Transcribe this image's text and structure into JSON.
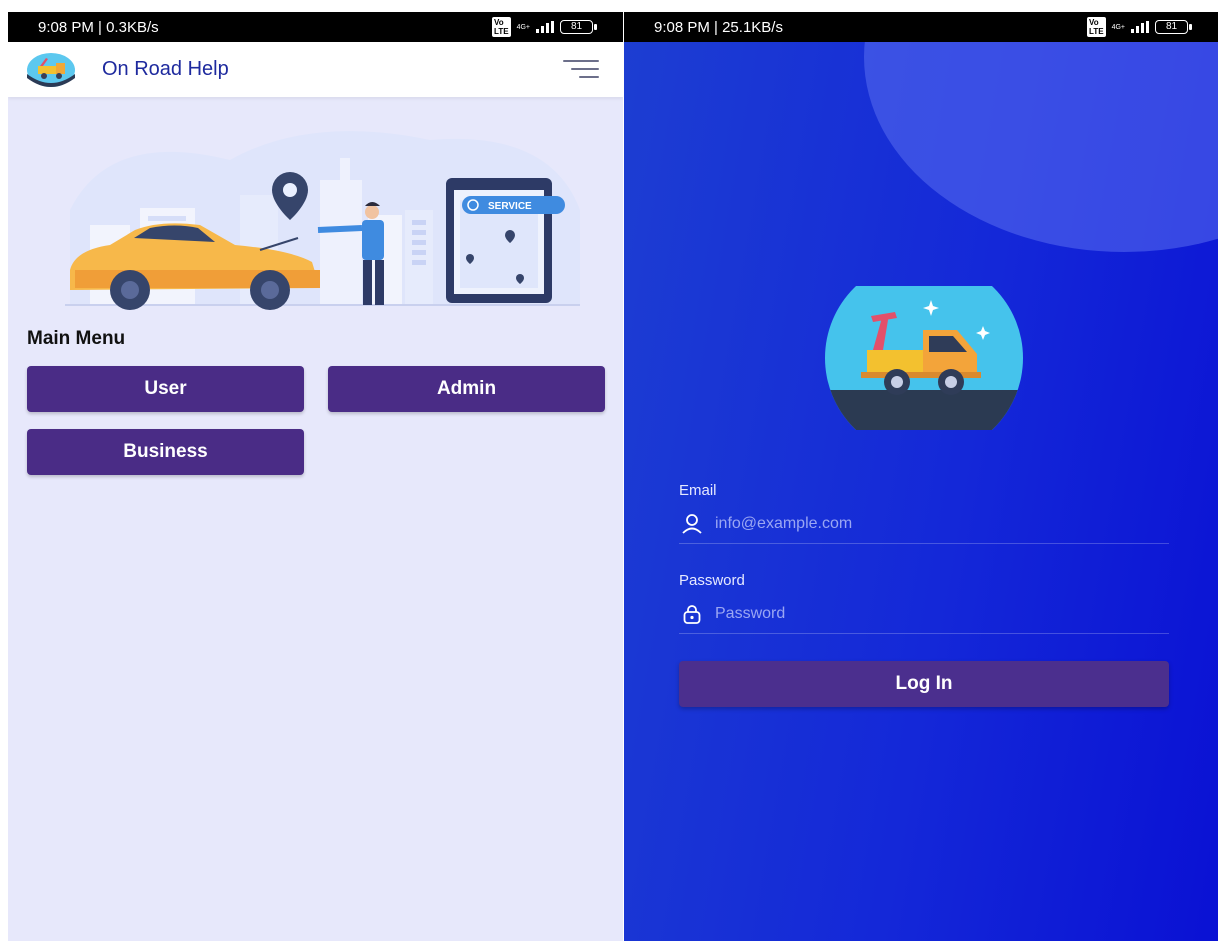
{
  "left_screen": {
    "status_bar": {
      "time_speed": "9:08 PM | 0.3KB/s",
      "volte": "VoLTE",
      "network": "4G+",
      "battery": "81"
    },
    "app_bar": {
      "title": "On Road Help",
      "logo_icon": "tow-truck-icon",
      "menu_icon": "hamburger-menu-icon"
    },
    "hero": {
      "badge_text": "SERVICE"
    },
    "menu": {
      "title": "Main Menu",
      "buttons": [
        {
          "label": "User"
        },
        {
          "label": "Admin"
        },
        {
          "label": "Business"
        }
      ]
    }
  },
  "right_screen": {
    "status_bar": {
      "time_speed": "9:08 PM | 25.1KB/s",
      "volte": "VoLTE",
      "network": "4G+",
      "battery": "81"
    },
    "logo_icon": "tow-truck-icon",
    "form": {
      "email_label": "Email",
      "email_placeholder": "info@example.com",
      "email_icon": "user-icon",
      "password_label": "Password",
      "password_placeholder": "Password",
      "password_icon": "lock-icon",
      "login_label": "Log In"
    }
  },
  "colors": {
    "button_purple": "#4a2c86",
    "left_background": "#e7e8fb",
    "right_background": "#1428d8",
    "title_blue": "#1e2a9e"
  }
}
